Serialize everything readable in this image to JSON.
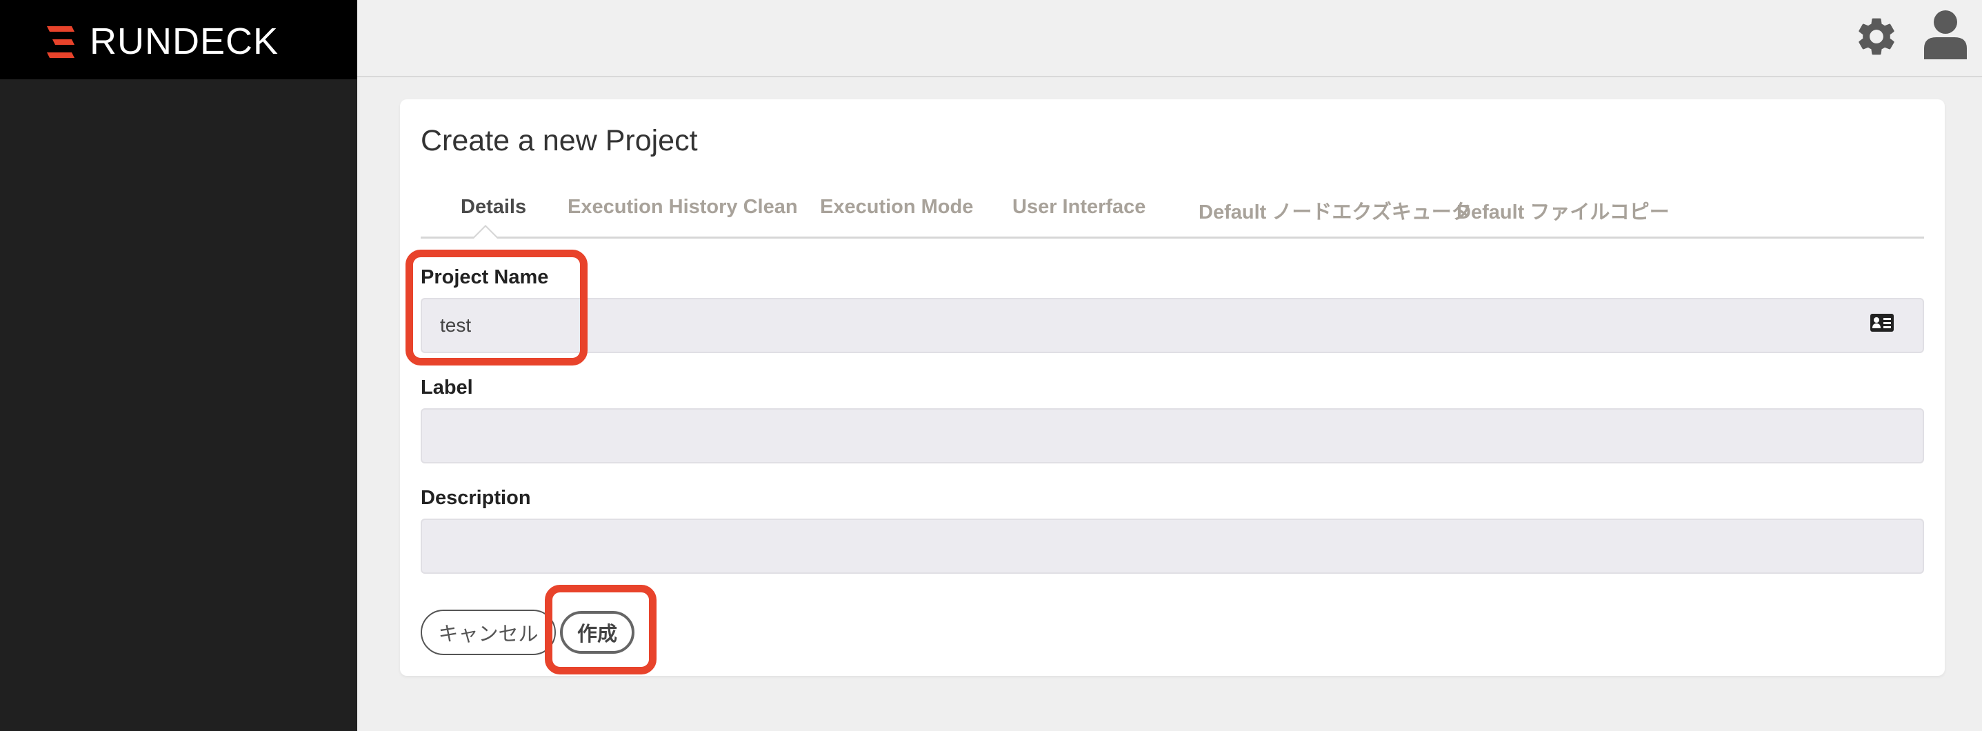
{
  "app": {
    "brand_name": "RUNDECK",
    "accent_color": "#e8432b"
  },
  "sidebar": {
    "collapse_icon": "chevron-left-icon"
  },
  "topbar": {
    "settings_icon": "gear-icon",
    "user_icon": "user-icon"
  },
  "form": {
    "title": "Create a new Project",
    "tabs": [
      {
        "label": "Details",
        "active": true
      },
      {
        "label": "Execution History Clean",
        "active": false
      },
      {
        "label": "Execution Mode",
        "active": false
      },
      {
        "label": "User Interface",
        "active": false
      },
      {
        "label": "Default ノードエクズキュータ",
        "active": false
      },
      {
        "label": "Default ファイルコピー",
        "active": false
      }
    ],
    "project_name": {
      "label": "Project Name",
      "value": "test"
    },
    "label_field": {
      "label": "Label",
      "value": ""
    },
    "description_field": {
      "label": "Description",
      "value": ""
    },
    "cancel_label": "キャンセル",
    "create_label": "作成"
  }
}
